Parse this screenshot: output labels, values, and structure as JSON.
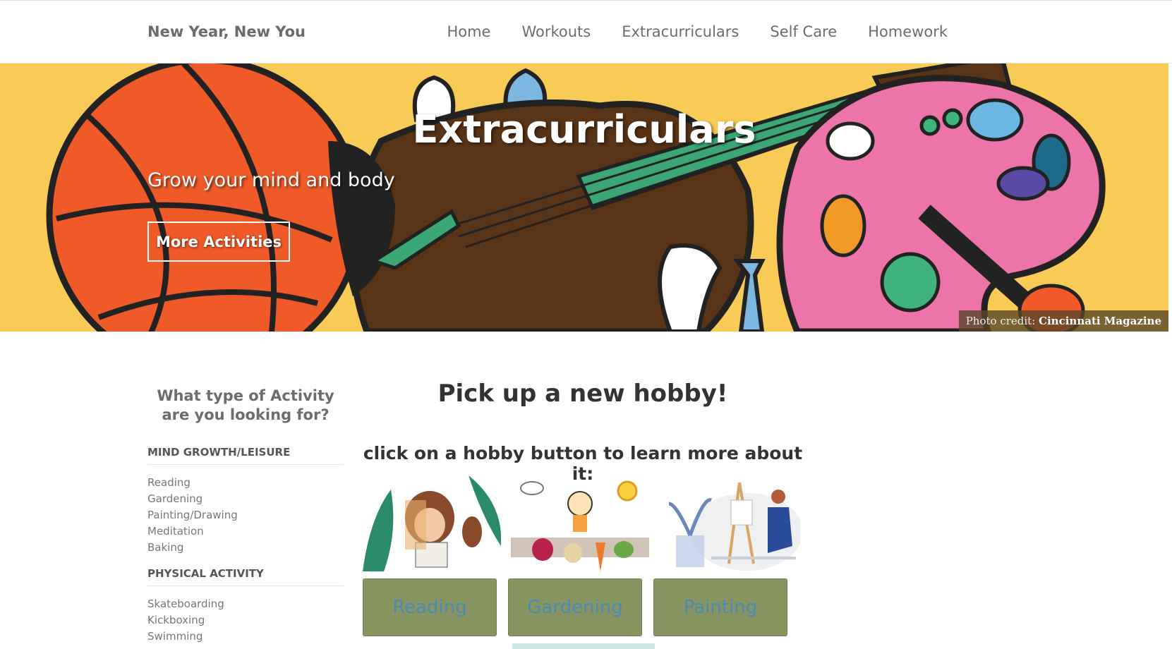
{
  "navbar": {
    "brand": "New Year, New You",
    "links": [
      "Home",
      "Workouts",
      "Extracurriculars",
      "Self Care",
      "Homework"
    ]
  },
  "hero": {
    "title": "Extracurriculars",
    "subtitle": "Grow your mind and body",
    "button": "More Activities",
    "credit_label": "Photo credit:",
    "credit_source": "Cincinnati Magazine",
    "background_color": "#f7cb55"
  },
  "sidebar": {
    "question": "What type of Activity are you looking for?",
    "categories": [
      {
        "title": "MIND GROWTH/LEISURE",
        "items": [
          "Reading",
          "Gardening",
          "Painting/Drawing",
          "Meditation",
          "Baking"
        ]
      },
      {
        "title": "PHYSICAL ACTIVITY",
        "items": [
          "Skateboarding",
          "Kickboxing",
          "Swimming"
        ]
      }
    ]
  },
  "main": {
    "title": "Pick up a new hobby!",
    "subtitle": "click on a hobby button to learn more about it:",
    "hobbies": [
      {
        "label": "Reading",
        "icon": "reading-illustration"
      },
      {
        "label": "Gardening",
        "icon": "gardening-illustration"
      },
      {
        "label": "Painting",
        "icon": "painting-illustration"
      }
    ],
    "button_color": "#879661",
    "button_text_color": "#4c8ab5"
  }
}
